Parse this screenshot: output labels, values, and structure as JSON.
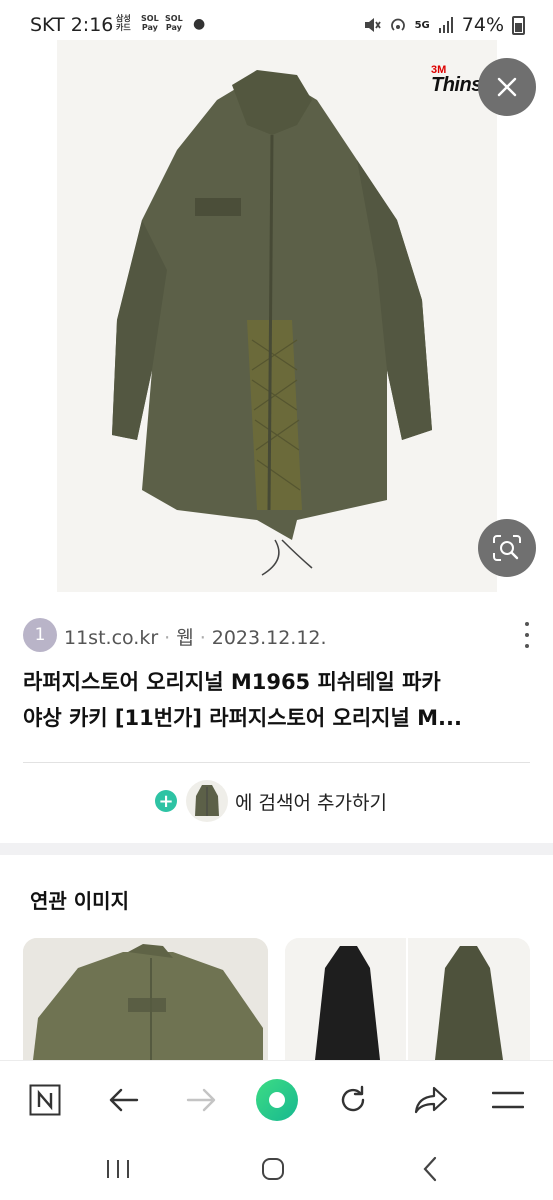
{
  "status_bar": {
    "carrier": "SKT",
    "time": "2:16",
    "notif_icons": [
      {
        "line1": "삼성",
        "line2": "카드"
      },
      {
        "line1": "SOL",
        "line2": "Pay"
      },
      {
        "line1": "SOL",
        "line2": "Pay"
      }
    ],
    "network": "5G",
    "battery": "74%",
    "icons": [
      "mute-icon",
      "hotspot-icon",
      "signal-icon",
      "battery-icon"
    ]
  },
  "image_viewer": {
    "overlay_logo_brand": "3M",
    "overlay_logo_text": "Thinsulate",
    "close_icon": "close-icon",
    "lens_icon": "image-search-icon"
  },
  "result": {
    "source_badge": "1",
    "source_domain": "11st.co.kr",
    "separator": "·",
    "source_type": "웹",
    "source_date": "2023.12.12.",
    "title_line1": "라퍼지스토어 오리지널 M1965 피쉬테일 파카",
    "title_line2": "야상 카키 [11번가] 라퍼지스토어 오리지널 M..."
  },
  "add_search": {
    "label": "에 검색어 추가하기"
  },
  "related": {
    "heading": "연관 이미지"
  },
  "toolbar": {
    "items": [
      "naver-home-icon",
      "back-arrow-icon",
      "forward-arrow-icon",
      "green-dot-icon",
      "refresh-icon",
      "share-icon",
      "menu-icon"
    ]
  },
  "nav_bar": {
    "items": [
      "recent-apps-icon",
      "home-icon",
      "back-icon"
    ]
  },
  "colors": {
    "accent_green": "#2ec3a4",
    "khaki": "#5a5e44",
    "badge": "#b9b4c8"
  }
}
